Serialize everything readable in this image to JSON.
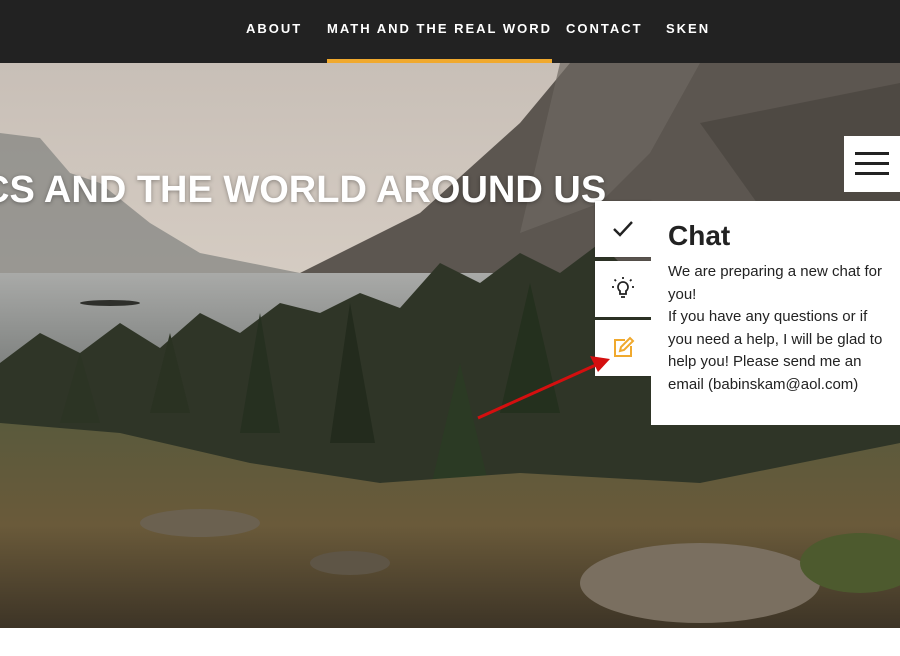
{
  "nav": {
    "items": [
      {
        "label": "ABOUT",
        "active": false
      },
      {
        "label": "MATH AND THE REAL WORD",
        "active": true
      },
      {
        "label": "CONTACT",
        "active": false
      },
      {
        "label": "SKEN",
        "active": false
      }
    ],
    "active_color": "#f0a92e"
  },
  "hero": {
    "title": "CS AND THE WORLD AROUND US"
  },
  "menu": {
    "icon": "hamburger-icon"
  },
  "tools": [
    {
      "icon": "check-icon"
    },
    {
      "icon": "lightbulb-icon"
    },
    {
      "icon": "edit-icon",
      "color": "#f0a92e"
    }
  ],
  "chat": {
    "title": "Chat",
    "lines": [
      "We are preparing a new chat for you!",
      "If you have any questions or if you need a help, I will be glad to help you! Please send me an email (babinskam@aol.com)"
    ]
  },
  "annotation": {
    "arrow_color": "#d40f0f"
  }
}
